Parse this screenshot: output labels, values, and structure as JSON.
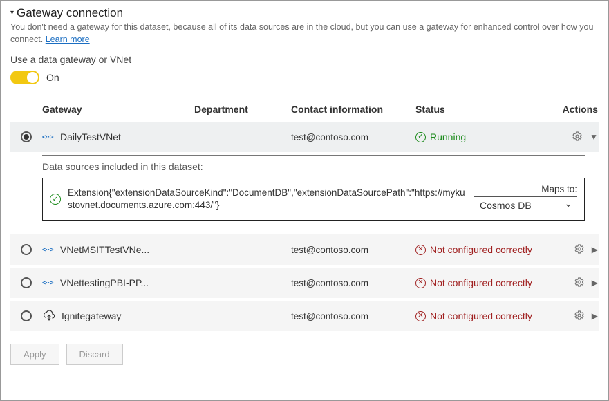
{
  "section": {
    "title": "Gateway connection",
    "description_prefix": "You don't need a gateway for this dataset, because all of its data sources are in the cloud, but you can use a gateway for enhanced control over how you connect. ",
    "learn_more": "Learn more"
  },
  "toggle": {
    "label": "Use a data gateway or VNet",
    "state_text": "On"
  },
  "columns": {
    "gateway": "Gateway",
    "department": "Department",
    "contact": "Contact information",
    "status": "Status",
    "actions": "Actions"
  },
  "rows": [
    {
      "selected": true,
      "icon": "vnet",
      "name": "DailyTestVNet",
      "department": "",
      "contact": "test@contoso.com",
      "status_kind": "ok",
      "status_text": "Running",
      "expanded": true
    },
    {
      "selected": false,
      "icon": "vnet",
      "name": "VNetMSITTestVNe...",
      "department": "",
      "contact": "test@contoso.com",
      "status_kind": "bad",
      "status_text": "Not configured correctly",
      "expanded": false
    },
    {
      "selected": false,
      "icon": "vnet",
      "name": "VNettestingPBI-PP...",
      "department": "",
      "contact": "test@contoso.com",
      "status_kind": "bad",
      "status_text": "Not configured correctly",
      "expanded": false
    },
    {
      "selected": false,
      "icon": "onprem",
      "name": "Ignitegateway",
      "department": "",
      "contact": "test@contoso.com",
      "status_kind": "bad",
      "status_text": "Not configured correctly",
      "expanded": false
    }
  ],
  "expanded": {
    "heading": "Data sources included in this dataset:",
    "source_text": "Extension{\"extensionDataSourceKind\":\"DocumentDB\",\"extensionDataSourcePath\":\"https://mykustovnet.documents.azure.com:443/\"}",
    "maps_label": "Maps to:",
    "maps_selected": "Cosmos DB"
  },
  "footer": {
    "apply": "Apply",
    "discard": "Discard"
  }
}
